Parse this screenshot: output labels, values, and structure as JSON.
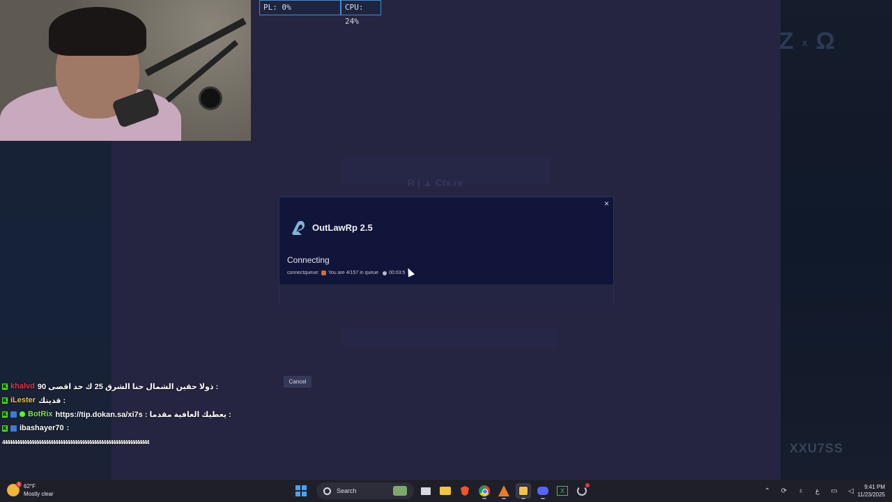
{
  "stream": {
    "stats": {
      "pl": "PL: 0%",
      "cpu": "CPU: 24%"
    },
    "watermark": "XXU7SS",
    "partner_logo_sep": "x"
  },
  "dialog": {
    "app_title": "OutLawRp 2.5",
    "status": "Connecting",
    "queue_prefix": "connectqueue:",
    "queue_text": "You are 4/157 in queue",
    "queue_time": "00:03:5",
    "cancel_label": "Cancel",
    "close_label": "×"
  },
  "chat": {
    "messages": [
      {
        "user": "khalvd",
        "text": ": ذولا حقين الشمال حنا الشرق 25 ك حد اقصى 90"
      },
      {
        "user": "iLester",
        "text": ": قديتك"
      },
      {
        "user": "BotRix",
        "text": ": يعطيك العافية مقدما : https://tip.dokan.sa/xi7s"
      },
      {
        "user": "ibashayer70",
        "text": ":"
      },
      {
        "user": "",
        "text": "4444444444444444444444444444444444444444444444444444444444444"
      }
    ]
  },
  "taskbar": {
    "weather_temp": "62°F",
    "weather_desc": "Mostly clear",
    "weather_badge": "2",
    "search_placeholder": "Search",
    "keyboard_lang": "ع",
    "time": "9:41 PM",
    "date": "11/23/2025",
    "icons": [
      "start-icon",
      "search-icon",
      "task-view-icon",
      "file-explorer-icon",
      "brave-icon",
      "chrome-icon",
      "app-icon",
      "app-icon-2",
      "discord-icon",
      "excel-icon",
      "loading-icon"
    ]
  },
  "colors": {
    "accent": "#4a8ad0",
    "kick_green": "#53fc18",
    "dialog_bg": "#12153a"
  }
}
